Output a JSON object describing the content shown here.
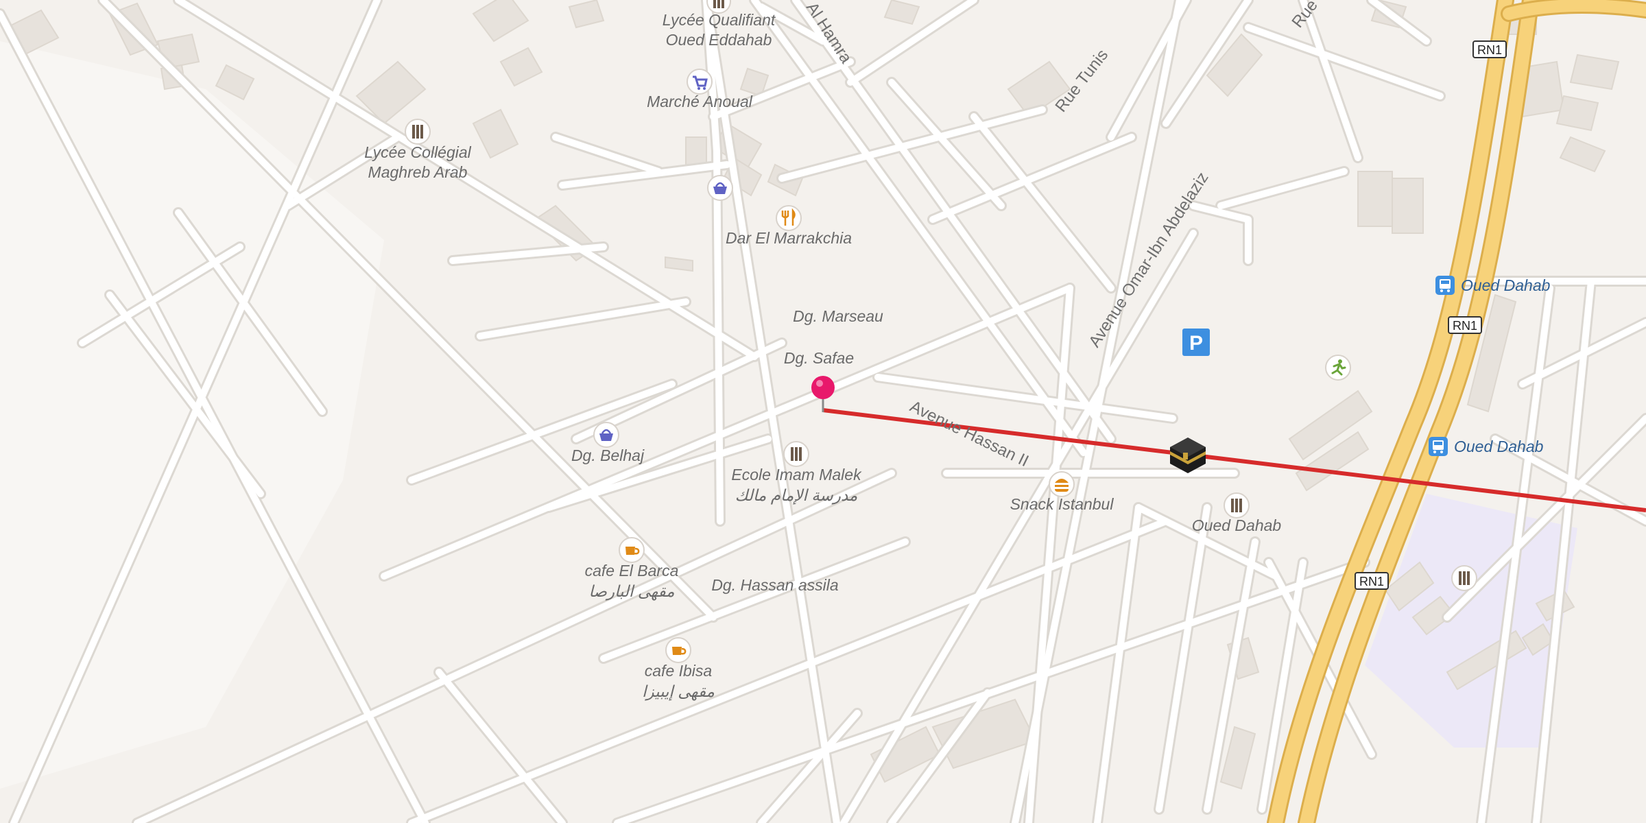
{
  "map": {
    "streets": {
      "avenue_hassan_ii": "Avenue Hassan II",
      "avenue_omar": "Avenue Omar-Ibn Abdelaziz",
      "rue_tunis": "Rue Tunis",
      "al_hamra": "Al Hamra",
      "rue_partial": "Rue"
    },
    "road_shields": [
      "RN1",
      "RN1",
      "RN1"
    ],
    "pois": {
      "lycee_qualifiant": [
        "Lycée Qualifiant",
        "Oued Eddahab"
      ],
      "marche_anoual": "Marché Anoual",
      "lycee_collegial": [
        "Lycée Collégial",
        "Maghreb Arab"
      ],
      "dar_el_marrakchia": "Dar El Marrakchia",
      "dg_marseau": "Dg. Marseau",
      "dg_safae": "Dg. Safae",
      "dg_belhaj": "Dg. Belhaj",
      "ecole_imam_malek": [
        "Ecole Imam Malek",
        "مدرسة الإمام مالك"
      ],
      "snack_istanbul": "Snack Istanbul",
      "oued_dahab_school": "Oued Dahab",
      "cafe_el_barca": [
        "cafe El Barca",
        "مقهى البارصا"
      ],
      "dg_hassan_assila": "Dg. Hassan assila",
      "cafe_ibisa": [
        "cafe Ibisa",
        "مقهى إيبيزا"
      ]
    },
    "bus_stops": [
      "Oued Dahab",
      "Oued Dahab"
    ],
    "parking_label": "P",
    "icons": {
      "school": "school-icon",
      "shop": "shopping-cart-icon",
      "basket": "shopping-basket-icon",
      "restaurant": "restaurant-icon",
      "cafe": "coffee-cup-icon",
      "fastfood": "burger-icon",
      "bus": "bus-stop-icon",
      "parking": "parking-icon",
      "sport": "running-person-icon",
      "pin": "location-pin-icon",
      "kaaba": "kaaba-icon"
    },
    "colors": {
      "background": "#f4f1ed",
      "road": "#ffffff",
      "road_edge": "#dcd8d2",
      "major_road": "#f7d27a",
      "major_road_edge": "#dcae4c",
      "building": "#e7e2dc",
      "school_area": "#ece8f7",
      "qibla_line": "#d62b2b",
      "pin": "#e8196b",
      "parking": "#3d8fe0",
      "sport": "#6aa53a",
      "poi_school": "#6c5a4a",
      "poi_shop": "#5f62c4",
      "poi_food": "#e08a16"
    }
  }
}
